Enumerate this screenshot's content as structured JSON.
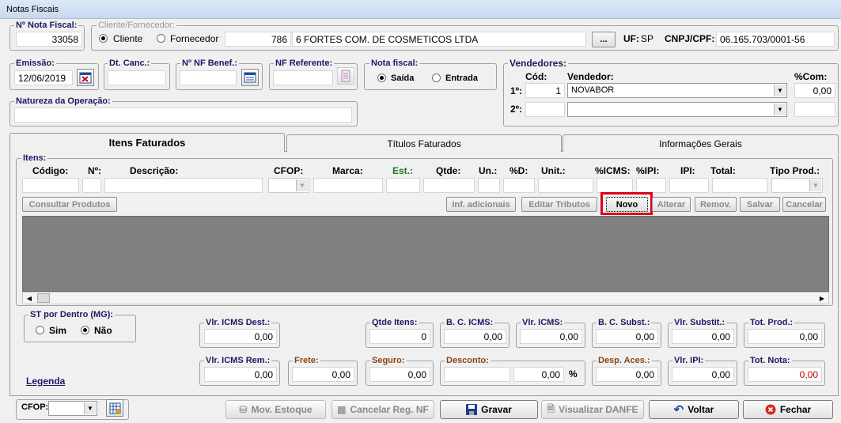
{
  "window": {
    "title": "Notas Fiscais"
  },
  "nota": {
    "label": "Nº Nota Fiscal:",
    "value": "33058"
  },
  "cliente": {
    "legend": "Cliente/Fornecedor:",
    "cliente_label": "Cliente",
    "fornecedor_label": "Fornecedor",
    "code": "786",
    "name": "6 FORTES COM. DE COSMETICOS LTDA",
    "browse": "...",
    "uf_label": "UF:",
    "uf": "SP",
    "cnpj_label": "CNPJ/CPF:",
    "cnpj": "06.165.703/0001-56"
  },
  "emissao": {
    "label": "Emissão:",
    "value": "12/06/2019"
  },
  "dtcanc": {
    "label": "Dt. Canc.:"
  },
  "nfbenef": {
    "label": "Nº NF Benef.:"
  },
  "nfref": {
    "label": "NF Referente:"
  },
  "notafiscal": {
    "legend": "Nota fiscal:",
    "saida": "Saída",
    "entrada": "Entrada"
  },
  "vendedores": {
    "legend": "Vendedores:",
    "cod_label": "Cód:",
    "vend_label": "Vendedor:",
    "pct_label": "%Com:",
    "row1_label": "1º:",
    "row1_cod": "1",
    "row1_name": "NOVABOR",
    "row1_pct": "0,00",
    "row2_label": "2º:"
  },
  "natureza": {
    "legend": "Natureza da Operação:"
  },
  "tabs": [
    "Itens Faturados",
    "Títulos Faturados",
    "Informações Gerais"
  ],
  "itens": {
    "legend": "Itens:",
    "cols": [
      "Código:",
      "Nº:",
      "Descrição:",
      "CFOP:",
      "Marca:",
      "Est.:",
      "Qtde:",
      "Un.:",
      "%D:",
      "Unit.:",
      "%ICMS:",
      "%IPI:",
      "IPI:",
      "Total:",
      "Tipo Prod.:"
    ],
    "consultar": "Consultar Produtos",
    "inf": "Inf. adicionais",
    "editar": "Editar Tributos",
    "novo": "Novo",
    "alterar": "Alterar",
    "remover": "Remov.",
    "salvar": "Salvar",
    "cancelar": "Cancelar"
  },
  "st": {
    "legend": "ST por Dentro (MG):",
    "sim": "Sim",
    "nao": "Não"
  },
  "legenda": "Legenda",
  "totals": {
    "vlr_icms_dest": {
      "label": "Vlr. ICMS Dest.:",
      "value": "0,00"
    },
    "qtde_itens": {
      "label": "Qtde Itens:",
      "value": "0"
    },
    "bc_icms": {
      "label": "B. C. ICMS:",
      "value": "0,00"
    },
    "vlr_icms": {
      "label": "Vlr. ICMS:",
      "value": "0,00"
    },
    "bc_subst": {
      "label": "B. C. Subst.:",
      "value": "0,00"
    },
    "vlr_subst": {
      "label": "Vlr. Substit.:",
      "value": "0,00"
    },
    "tot_prod": {
      "label": "Tot. Prod.:",
      "value": "0,00"
    },
    "vlr_icms_rem": {
      "label": "Vlr. ICMS Rem.:",
      "value": "0,00"
    },
    "frete": {
      "label": "Frete:",
      "value": "0,00"
    },
    "seguro": {
      "label": "Seguro:",
      "value": "0,00"
    },
    "desconto": {
      "label": "Desconto:",
      "value": "0,00",
      "pct": "%"
    },
    "desp_aces": {
      "label": "Desp. Aces.:",
      "value": "0,00"
    },
    "vlr_ipi": {
      "label": "Vlr. IPI:",
      "value": "0,00"
    },
    "tot_nota": {
      "label": "Tot. Nota:",
      "value": "0,00"
    }
  },
  "footer": {
    "cfop_label": "CFOP:",
    "mov_estoque": "Mov. Estoque",
    "cancelar_reg": "Cancelar Reg. NF",
    "gravar": "Gravar",
    "visualizar": "Visualizar DANFE",
    "voltar": "Voltar",
    "fechar": "Fechar"
  },
  "colors": {
    "legend": "#1a1a66",
    "orange_label": "#8b4513",
    "est_label": "#1a7a1a",
    "tot_nota_value": "#c00000",
    "highlight": "#e0001a",
    "grid": "#808080"
  }
}
